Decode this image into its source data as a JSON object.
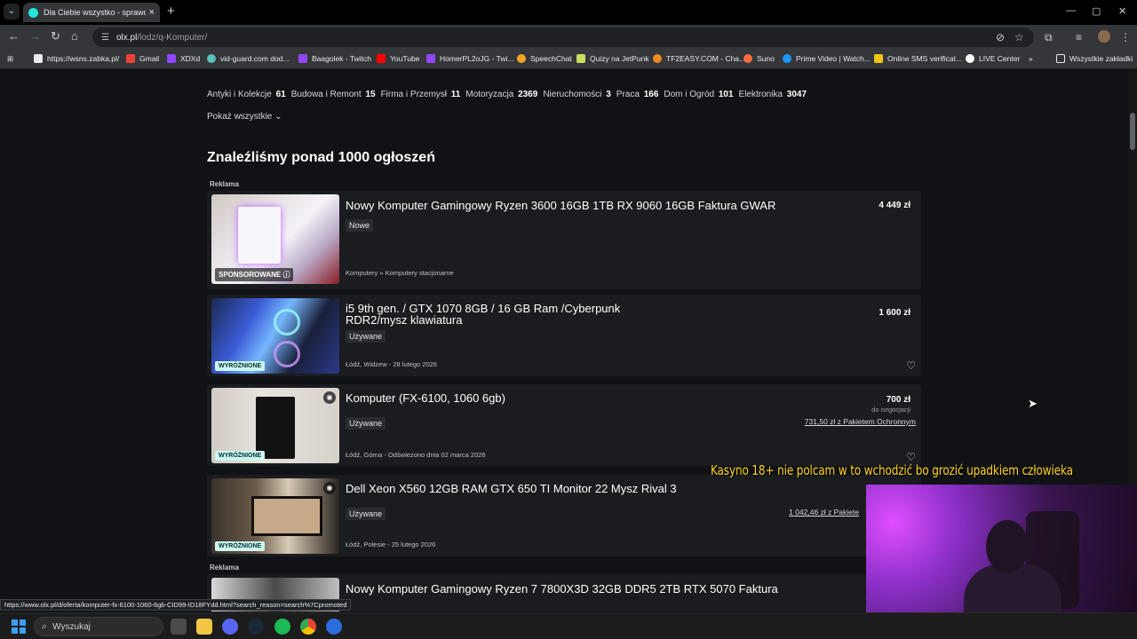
{
  "browser": {
    "tab_title": "Dla Ciebie wszystko - sprawdź og",
    "tab_close": "×",
    "new_tab": "+",
    "url_host": "olx.pl",
    "url_path": "/lodz/q-Komputer/",
    "window_controls": [
      "—",
      "▢",
      "✕"
    ]
  },
  "bookmarks": [
    {
      "label": "https://wsns.zabka.pl/",
      "color": "#e8eaed"
    },
    {
      "label": "Gmail",
      "color": "#ea4335"
    },
    {
      "label": "XDXd",
      "color": "#9146ff"
    },
    {
      "label": "vid-guard.com dod...",
      "color": "#5bc0be"
    },
    {
      "label": "Baagolek - Twitch",
      "color": "#9146ff"
    },
    {
      "label": "YouTube",
      "color": "#ff0000"
    },
    {
      "label": "HomerPL2oJG - Twi...",
      "color": "#9146ff"
    },
    {
      "label": "SpeechChat",
      "color": "#f5a623"
    },
    {
      "label": "Quizy na JetPunk",
      "color": "#c5e063"
    },
    {
      "label": "TF2EASY.COM - Cha...",
      "color": "#f08a24"
    },
    {
      "label": "Suno",
      "color": "#ff6b3d"
    },
    {
      "label": "Prime Video | Watch...",
      "color": "#1a98ff"
    },
    {
      "label": "Online SMS verificat...",
      "color": "#f1c40f"
    },
    {
      "label": "LIVE Center",
      "color": "#ffffff"
    },
    {
      "label": "»",
      "color": ""
    },
    {
      "label": "Wszystkie zakładki",
      "color": "#e8eaed"
    }
  ],
  "categories": [
    {
      "name": "Antyki i Kolekcje",
      "count": "61"
    },
    {
      "name": "Budowa i Remont",
      "count": "15"
    },
    {
      "name": "Firma i Przemysł",
      "count": "11"
    },
    {
      "name": "Motoryzacja",
      "count": "2369"
    },
    {
      "name": "Nieruchomości",
      "count": "3"
    },
    {
      "name": "Praca",
      "count": "166"
    },
    {
      "name": "Dom i Ogród",
      "count": "101"
    },
    {
      "name": "Elektronika",
      "count": "3047"
    }
  ],
  "show_all": "Pokaż wszystkie",
  "results_heading": "Znaleźliśmy ponad 1000 ogłoszeń",
  "ad_label": "Reklama",
  "listings": [
    {
      "title": "Nowy Komputer Gamingowy Ryzen 3600 16GB 1TB RX 9060 16GB Faktura GWAR",
      "condition": "Nowe",
      "meta": "Komputery » Komputery stacjonarne",
      "price": "4 449 zł",
      "badge": "SPONSOROWANE ⓘ"
    },
    {
      "title": "i5 9th gen. / GTX 1070 8GB / 16 GB Ram /Cyberpunk RDR2/mysz klawiatura",
      "condition": "Używane",
      "meta": "Łódź, Widzew - 28 lutego 2026",
      "price": "1 600 zł",
      "badge": "WYRÓŻNIONE"
    },
    {
      "title": "Komputer (FX-6100, 1060 6gb)",
      "condition": "Używane",
      "meta": "Łódź, Górna - Odświeżono dnia 02 marca 2026",
      "price": "700 zł",
      "negotiation": "do negocjacji",
      "protection": "731,50 zł z Pakietem Ochronnym",
      "badge": "WYRÓŻNIONE"
    },
    {
      "title": "Dell Xeon X560 12GB RAM GTX 650 TI Monitor 22 Mysz Rival 3",
      "condition": "Używane",
      "meta": "Łódź, Polesie - 25 lutego 2026",
      "protection": "1 042,46 zł z Pakiete",
      "badge": "WYRÓŻNIONE"
    },
    {
      "title": "Nowy Komputer Gamingowy Ryzen 7 7800X3D 32GB DDR5 2TB RTX 5070 Faktura"
    }
  ],
  "stream_overlay": "Kasyno 18+ nie polcam w to wchodzić bo grozić upadkiem człowieka",
  "status_url": "https://www.olx.pl/d/oferta/komputer-fx-6100-1060-6gb-CID99-ID18FYdd.html?search_reason=search%7Cpromoted",
  "taskbar": {
    "search_placeholder": "Wyszukaj"
  }
}
